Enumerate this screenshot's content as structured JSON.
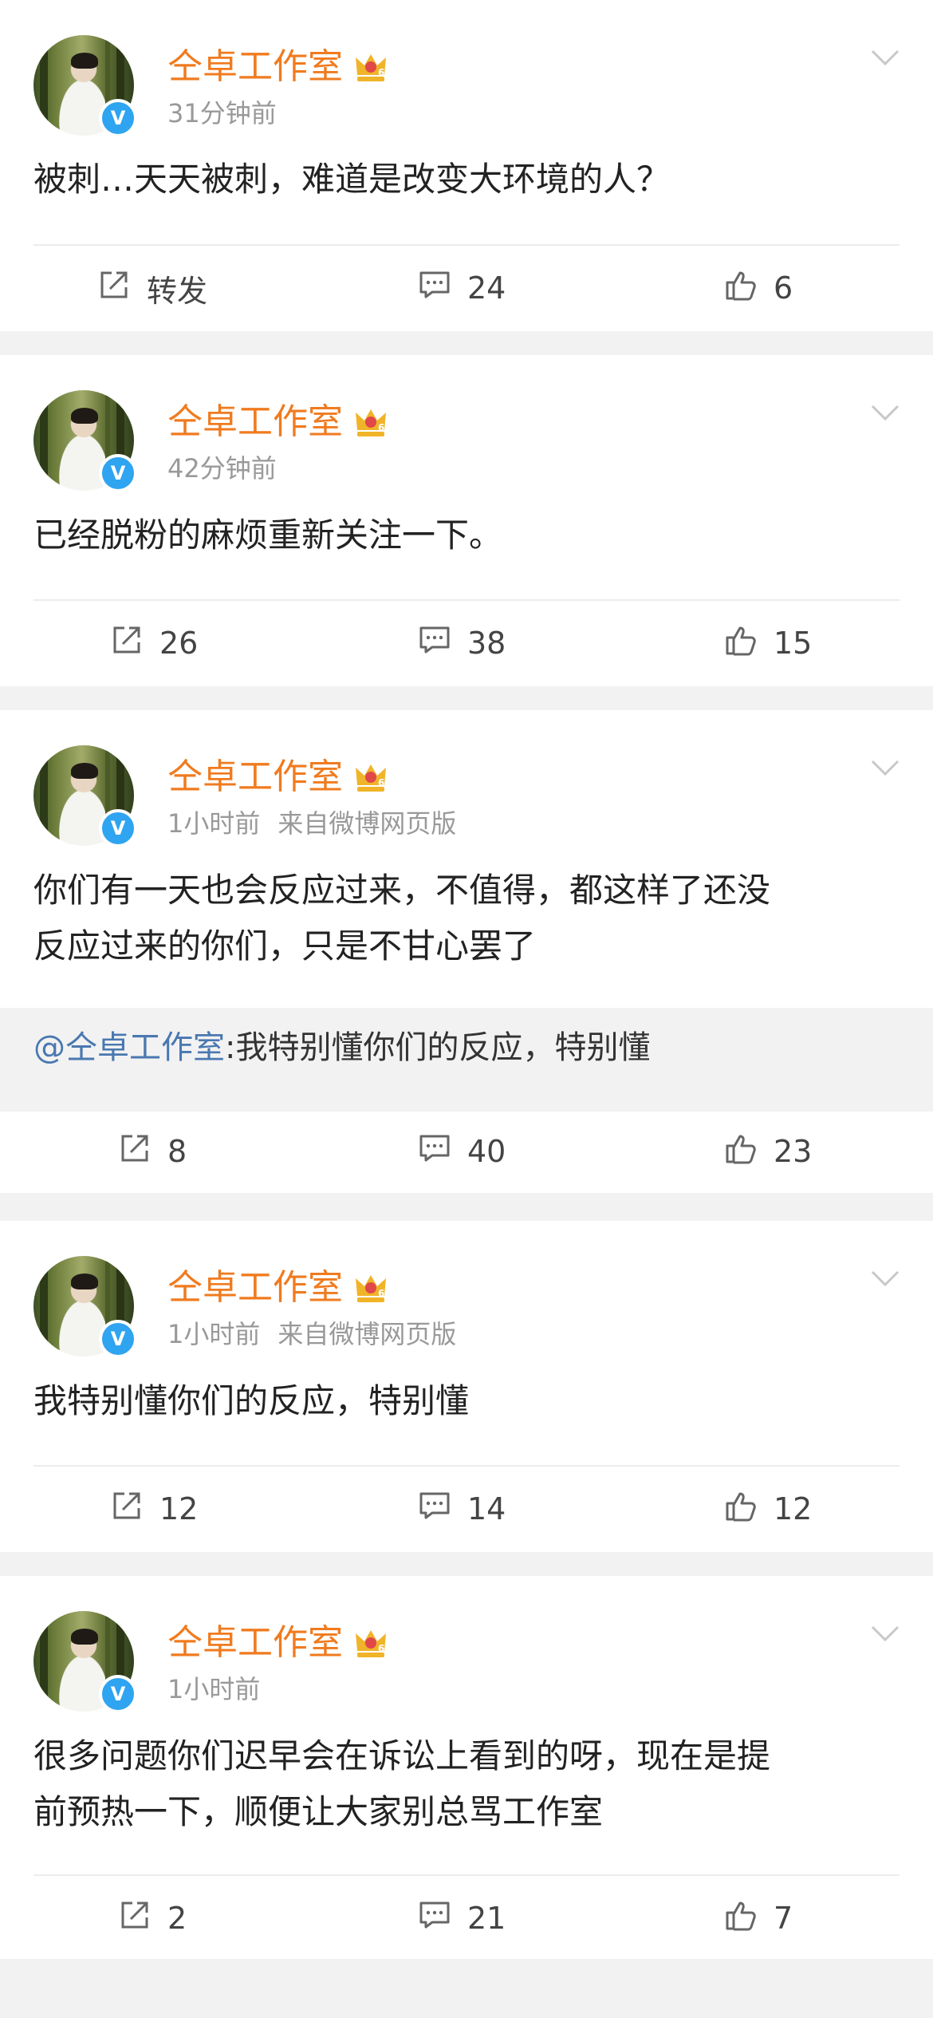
{
  "posts": [
    {
      "author": "仝卓工作室",
      "time": "31分钟前",
      "source": "",
      "text": "被刺…天天被刺，难道是改变大环境的人？",
      "repost": null,
      "actions": {
        "share": "转发",
        "comment": "24",
        "like": "6"
      }
    },
    {
      "author": "仝卓工作室",
      "time": "42分钟前",
      "source": "",
      "text": "已经脱粉的麻烦重新关注一下。",
      "repost": null,
      "actions": {
        "share": "26",
        "comment": "38",
        "like": "15"
      }
    },
    {
      "author": "仝卓工作室",
      "time": "1小时前",
      "source": "来自微博网页版",
      "text": "你们有一天也会反应过来，不值得，都这样了还没\n反应过来的你们，只是不甘心罢了",
      "repost": {
        "mention": "@仝卓工作室",
        "text": ":我特别懂你们的反应，特别懂"
      },
      "actions": {
        "share": "8",
        "comment": "40",
        "like": "23"
      }
    },
    {
      "author": "仝卓工作室",
      "time": "1小时前",
      "source": "来自微博网页版",
      "text": "我特别懂你们的反应，特别懂",
      "repost": null,
      "actions": {
        "share": "12",
        "comment": "14",
        "like": "12"
      }
    },
    {
      "author": "仝卓工作室",
      "time": "1小时前",
      "source": "",
      "text": "很多问题你们迟早会在诉讼上看到的呀，现在是提\n前预热一下，顺便让大家别总骂工作室",
      "repost": null,
      "actions": {
        "share": "2",
        "comment": "21",
        "like": "7"
      }
    }
  ],
  "icons": {
    "verified": "V",
    "crown_color": "#f0b429",
    "name_color": "#f07b1f",
    "mention_color": "#4a78b0"
  }
}
